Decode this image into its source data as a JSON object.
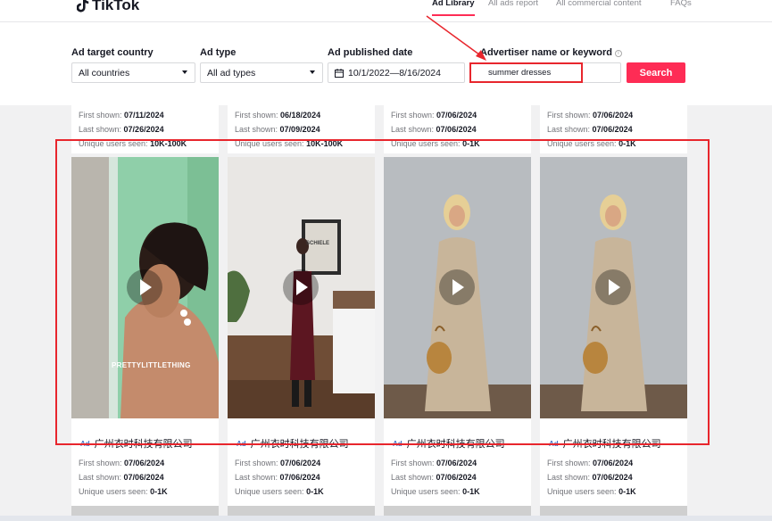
{
  "header": {
    "logo": "TikTok",
    "nav": [
      "Ad Library",
      "All ads report",
      "All commercial content",
      "FAQs"
    ]
  },
  "filters": {
    "country_label": "Ad target country",
    "country_value": "All countries",
    "type_label": "Ad type",
    "type_value": "All ad types",
    "date_label": "Ad published date",
    "date_value": "10/1/2022—8/16/2024",
    "keyword_label": "Advertiser name or keyword",
    "keyword_info": "i",
    "keyword_value": "summer dresses",
    "search_label": "Search"
  },
  "labels": {
    "first": "First shown:",
    "last": "Last shown:",
    "users": "Unique users seen:",
    "ad": "Ad"
  },
  "top_cards": [
    {
      "first": "07/11/2024",
      "last": "07/26/2024",
      "users": "10K-100K"
    },
    {
      "first": "06/18/2024",
      "last": "07/09/2024",
      "users": "10K-100K"
    },
    {
      "first": "07/06/2024",
      "last": "07/06/2024",
      "users": "0-1K"
    },
    {
      "first": "07/06/2024",
      "last": "07/06/2024",
      "users": "0-1K"
    }
  ],
  "videos": [
    {
      "advertiser": "广州衣时科技有限公司",
      "overlay": "PRETTYLITTLETHING"
    },
    {
      "advertiser": "广州衣时科技有限公司",
      "overlay": "SCHIELE"
    },
    {
      "advertiser": "广州衣时科技有限公司"
    },
    {
      "advertiser": "广州衣时科技有限公司"
    }
  ],
  "bottom_cards": [
    {
      "first": "07/06/2024",
      "last": "07/06/2024",
      "users": "0-1K"
    },
    {
      "first": "07/06/2024",
      "last": "07/06/2024",
      "users": "0-1K"
    },
    {
      "first": "07/06/2024",
      "last": "07/06/2024",
      "users": "0-1K"
    },
    {
      "first": "07/06/2024",
      "last": "07/06/2024",
      "users": "0-1K"
    }
  ],
  "colors": {
    "brand": "#fe2c55",
    "annotation": "#e8262d",
    "ad_badge": "#4a74c4"
  }
}
